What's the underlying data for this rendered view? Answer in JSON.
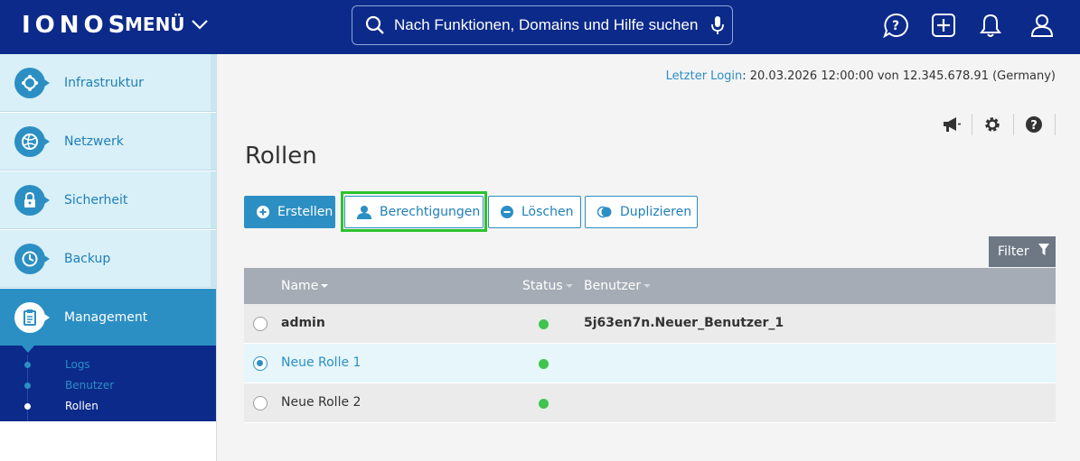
{
  "app": {
    "logo": "IONOS",
    "menu_label": "MENÜ",
    "search_placeholder": "Nach Funktionen, Domains und Hilfe suchen",
    "top_icons": [
      "chat-question-icon",
      "plus-box-icon",
      "bell-icon",
      "user-icon"
    ]
  },
  "sidebar": {
    "items": [
      {
        "label": "Infrastruktur",
        "icon": "infrastructure-icon"
      },
      {
        "label": "Netzwerk",
        "icon": "network-icon"
      },
      {
        "label": "Sicherheit",
        "icon": "lock-icon"
      },
      {
        "label": "Backup",
        "icon": "backup-clock-icon"
      },
      {
        "label": "Management",
        "icon": "clipboard-icon",
        "active": true
      }
    ],
    "sub_items": [
      {
        "label": "Logs"
      },
      {
        "label": "Benutzer"
      },
      {
        "label": "Rollen",
        "current": true
      }
    ]
  },
  "main": {
    "last_login_link": "Letzter Login",
    "last_login_text": ": 20.03.2026 12:00:00 von 12.345.678.91 (Germany)",
    "utility_icons": [
      "megaphone-icon",
      "gear-icon",
      "help-icon"
    ],
    "title": "Rollen",
    "buttons": {
      "create": "Erstellen",
      "permissions": "Berechtigungen",
      "delete": "Löschen",
      "duplicate": "Duplizieren"
    },
    "filter_label": "Filter",
    "table": {
      "columns": [
        "Name",
        "Status",
        "Benutzer"
      ],
      "rows": [
        {
          "name": "admin",
          "status": "active",
          "users": "5j63en7n.Neuer_Benutzer_1",
          "selected": false
        },
        {
          "name": "Neue Rolle 1",
          "status": "active",
          "users": "",
          "selected": true
        },
        {
          "name": "Neue Rolle 2",
          "status": "active",
          "users": "",
          "selected": false
        }
      ]
    }
  },
  "colors": {
    "topbar": "#0b2a8a",
    "accent": "#2c8fc4",
    "sidebar_bg": "#d9f0f8",
    "highlight": "#2bc32b",
    "status_ok": "#3fc450",
    "table_header": "#a5acb6"
  }
}
